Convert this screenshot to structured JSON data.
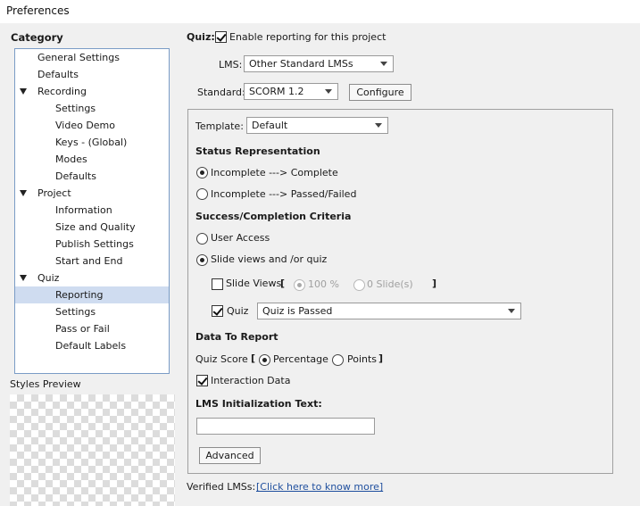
{
  "window": {
    "title": "Preferences"
  },
  "sidebar": {
    "category_title": "Category",
    "items": [
      {
        "label": "General Settings",
        "level": 1
      },
      {
        "label": "Defaults",
        "level": 1
      },
      {
        "label": "Recording",
        "level": 1,
        "expandable": true
      },
      {
        "label": "Settings",
        "level": 2
      },
      {
        "label": "Video Demo",
        "level": 2
      },
      {
        "label": "Keys - (Global)",
        "level": 2
      },
      {
        "label": "Modes",
        "level": 2
      },
      {
        "label": "Defaults",
        "level": 2
      },
      {
        "label": "Project",
        "level": 1,
        "expandable": true
      },
      {
        "label": "Information",
        "level": 2
      },
      {
        "label": "Size and Quality",
        "level": 2
      },
      {
        "label": "Publish Settings",
        "level": 2
      },
      {
        "label": "Start and End",
        "level": 2
      },
      {
        "label": "Quiz",
        "level": 1,
        "expandable": true
      },
      {
        "label": "Reporting",
        "level": 2,
        "selected": true
      },
      {
        "label": "Settings",
        "level": 2
      },
      {
        "label": "Pass or Fail",
        "level": 2
      },
      {
        "label": "Default Labels",
        "level": 2
      }
    ],
    "styles_preview_label": "Styles Preview"
  },
  "main": {
    "quiz_label": "Quiz:",
    "enable_reporting_label": "Enable reporting for this project",
    "enable_reporting_checked": true,
    "lms_label": "LMS:",
    "lms_value": "Other Standard LMSs",
    "standard_label": "Standard:",
    "standard_value": "SCORM 1.2",
    "configure_label": "Configure",
    "template_label": "Template:",
    "template_value": "Default",
    "status_heading": "Status Representation",
    "status_opt1": "Incomplete ---> Complete",
    "status_opt2": "Incomplete ---> Passed/Failed",
    "status_selected": 1,
    "criteria_heading": "Success/Completion Criteria",
    "user_access_label": "User Access",
    "slide_views_quiz_label": "Slide views and /or quiz",
    "criteria_selected": 2,
    "slide_views_label": "Slide Views",
    "bracket_open": "[",
    "bracket_close": "]",
    "percent_option": "100 %",
    "slides_option": "0 Slide(s)",
    "quiz_check_label": "Quiz",
    "quiz_check_checked": true,
    "quiz_condition_value": "Quiz is Passed",
    "data_heading": "Data To Report",
    "quiz_score_label": "Quiz Score",
    "percentage_label": "Percentage",
    "points_label": "Points",
    "quiz_score_selected": "Percentage",
    "interaction_data_label": "Interaction Data",
    "interaction_data_checked": true,
    "lms_init_heading": "LMS Initialization Text:",
    "lms_init_value": "",
    "advanced_label": "Advanced",
    "verified_label": "Verified LMSs:",
    "verified_link": "[Click here to know more]"
  }
}
